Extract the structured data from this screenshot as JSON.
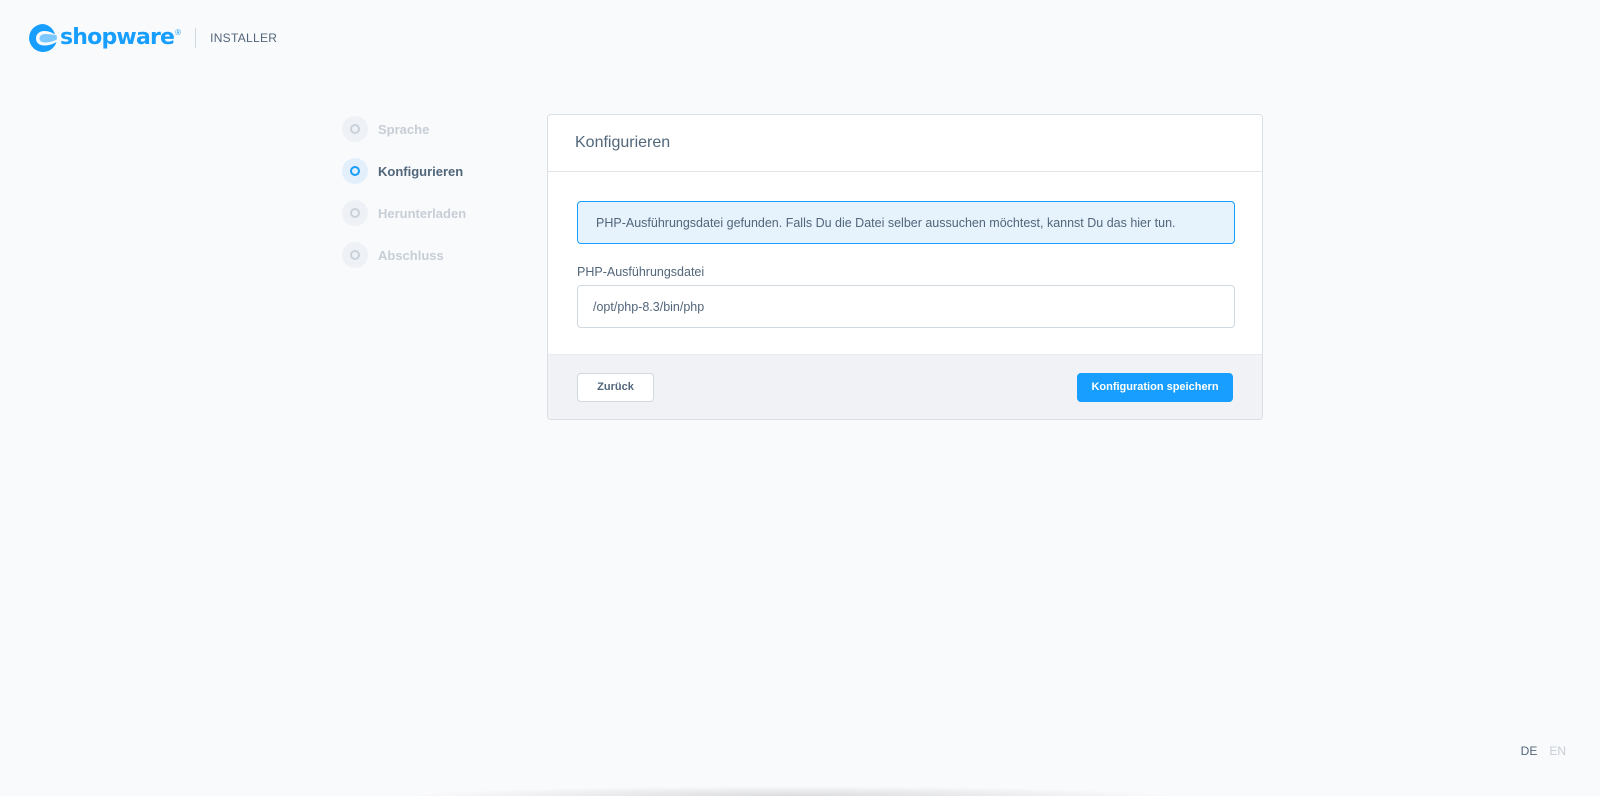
{
  "header": {
    "logo_text": "shopware",
    "logo_reg": "®",
    "title": "INSTALLER"
  },
  "steps": [
    {
      "label": "Sprache",
      "state": "inactive"
    },
    {
      "label": "Konfigurieren",
      "state": "active"
    },
    {
      "label": "Herunterladen",
      "state": "inactive"
    },
    {
      "label": "Abschluss",
      "state": "inactive"
    }
  ],
  "card": {
    "title": "Konfigurieren",
    "alert_text": "PHP-Ausführungsdatei gefunden. Falls Du die Datei selber aussuchen möchtest, kannst Du das hier tun.",
    "field_label": "PHP-Ausführungsdatei",
    "field_value": "/opt/php-8.3/bin/php",
    "back_label": "Zurück",
    "save_label": "Konfiguration speichern"
  },
  "language": {
    "options": [
      {
        "label": "DE",
        "active": true
      },
      {
        "label": "EN",
        "active": false
      }
    ]
  },
  "colors": {
    "accent": "#189eff",
    "text": "#52667a",
    "background": "#f9fafc",
    "alert_bg": "#e6f3fd"
  }
}
